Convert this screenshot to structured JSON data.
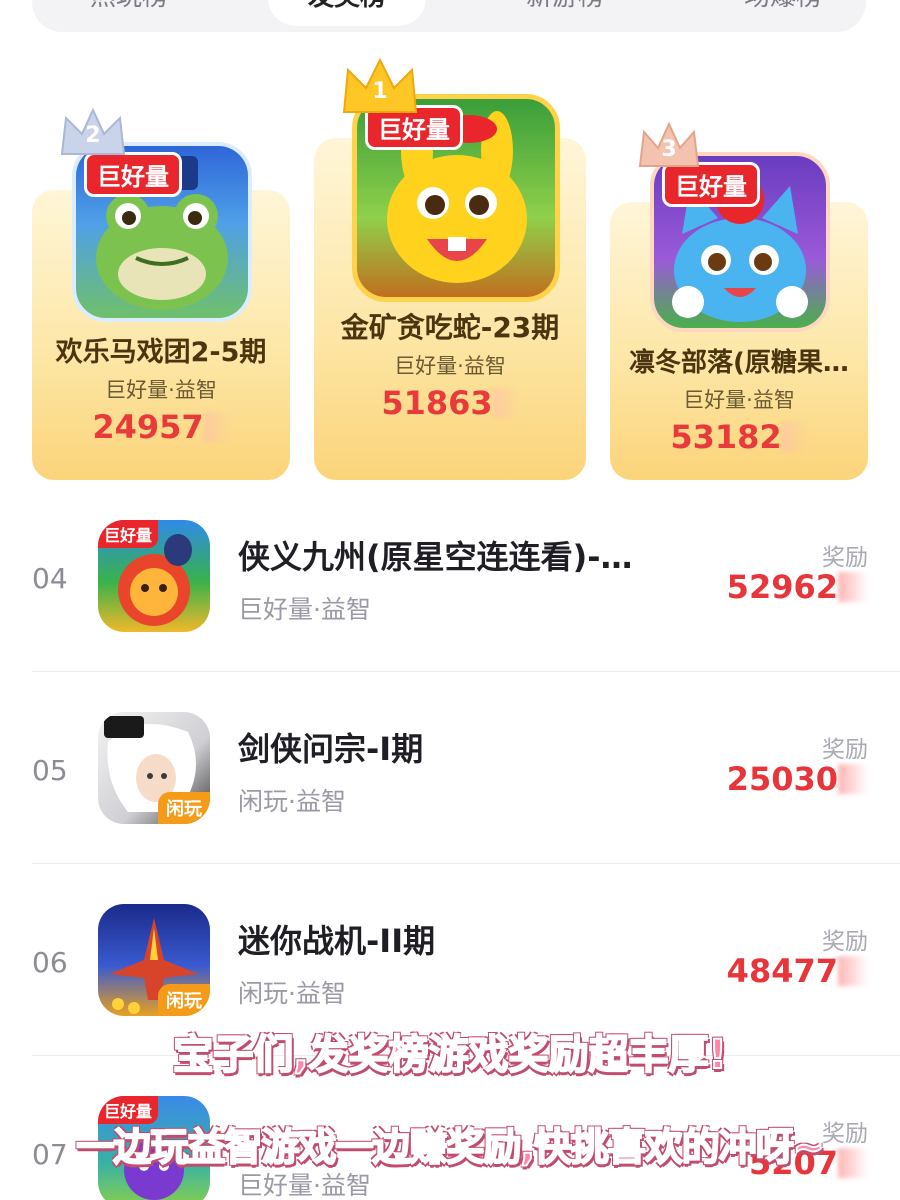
{
  "tabs": [
    {
      "label": "热玩榜",
      "active": false
    },
    {
      "label": "发奖榜",
      "active": true
    },
    {
      "label": "新游榜",
      "active": false
    },
    {
      "label": "场爆榜",
      "active": false
    }
  ],
  "podium": [
    {
      "rank": "2",
      "badge": "巨好量",
      "title": "欢乐马戏团2-5期",
      "subtitle": "巨好量·益智",
      "amount": "24957",
      "icon": "frog-game-icon"
    },
    {
      "rank": "1",
      "badge": "巨好量",
      "title": "金矿贪吃蛇-23期",
      "subtitle": "巨好量·益智",
      "amount": "51863",
      "icon": "yellow-rabbit-game-icon"
    },
    {
      "rank": "3",
      "badge": "巨好量",
      "title": "凛冬部落(原糖果…",
      "subtitle": "巨好量·益智",
      "amount": "53182",
      "icon": "blue-cat-game-icon"
    }
  ],
  "list": [
    {
      "rank": "04",
      "title": "侠义九州(原星空连连看)-…",
      "subtitle": "巨好量·益智",
      "reward_label": "奖励",
      "amount": "52962",
      "tag": "巨好量",
      "tag_pos": "tl"
    },
    {
      "rank": "05",
      "title": "剑侠问宗-I期",
      "subtitle": "闲玩·益智",
      "reward_label": "奖励",
      "amount": "25030",
      "tag": "闲玩",
      "tag_pos": "br"
    },
    {
      "rank": "06",
      "title": "迷你战机-II期",
      "subtitle": "闲玩·益智",
      "reward_label": "奖励",
      "amount": "48477",
      "tag": "闲玩",
      "tag_pos": "br"
    },
    {
      "rank": "07",
      "title": "",
      "subtitle": "巨好量·益智",
      "reward_label": "奖励",
      "amount": "5207",
      "tag": "巨好量",
      "tag_pos": "tl"
    }
  ],
  "captions": {
    "line1": "宝子们,发奖榜游戏奖励超丰厚!",
    "line2": "一边玩益智游戏一边赚奖励,快挑喜欢的冲呀~"
  },
  "colors": {
    "accent_red": "#e8353a",
    "card_gold": "#fbd47a",
    "caption_pink": "#ff86a6"
  }
}
